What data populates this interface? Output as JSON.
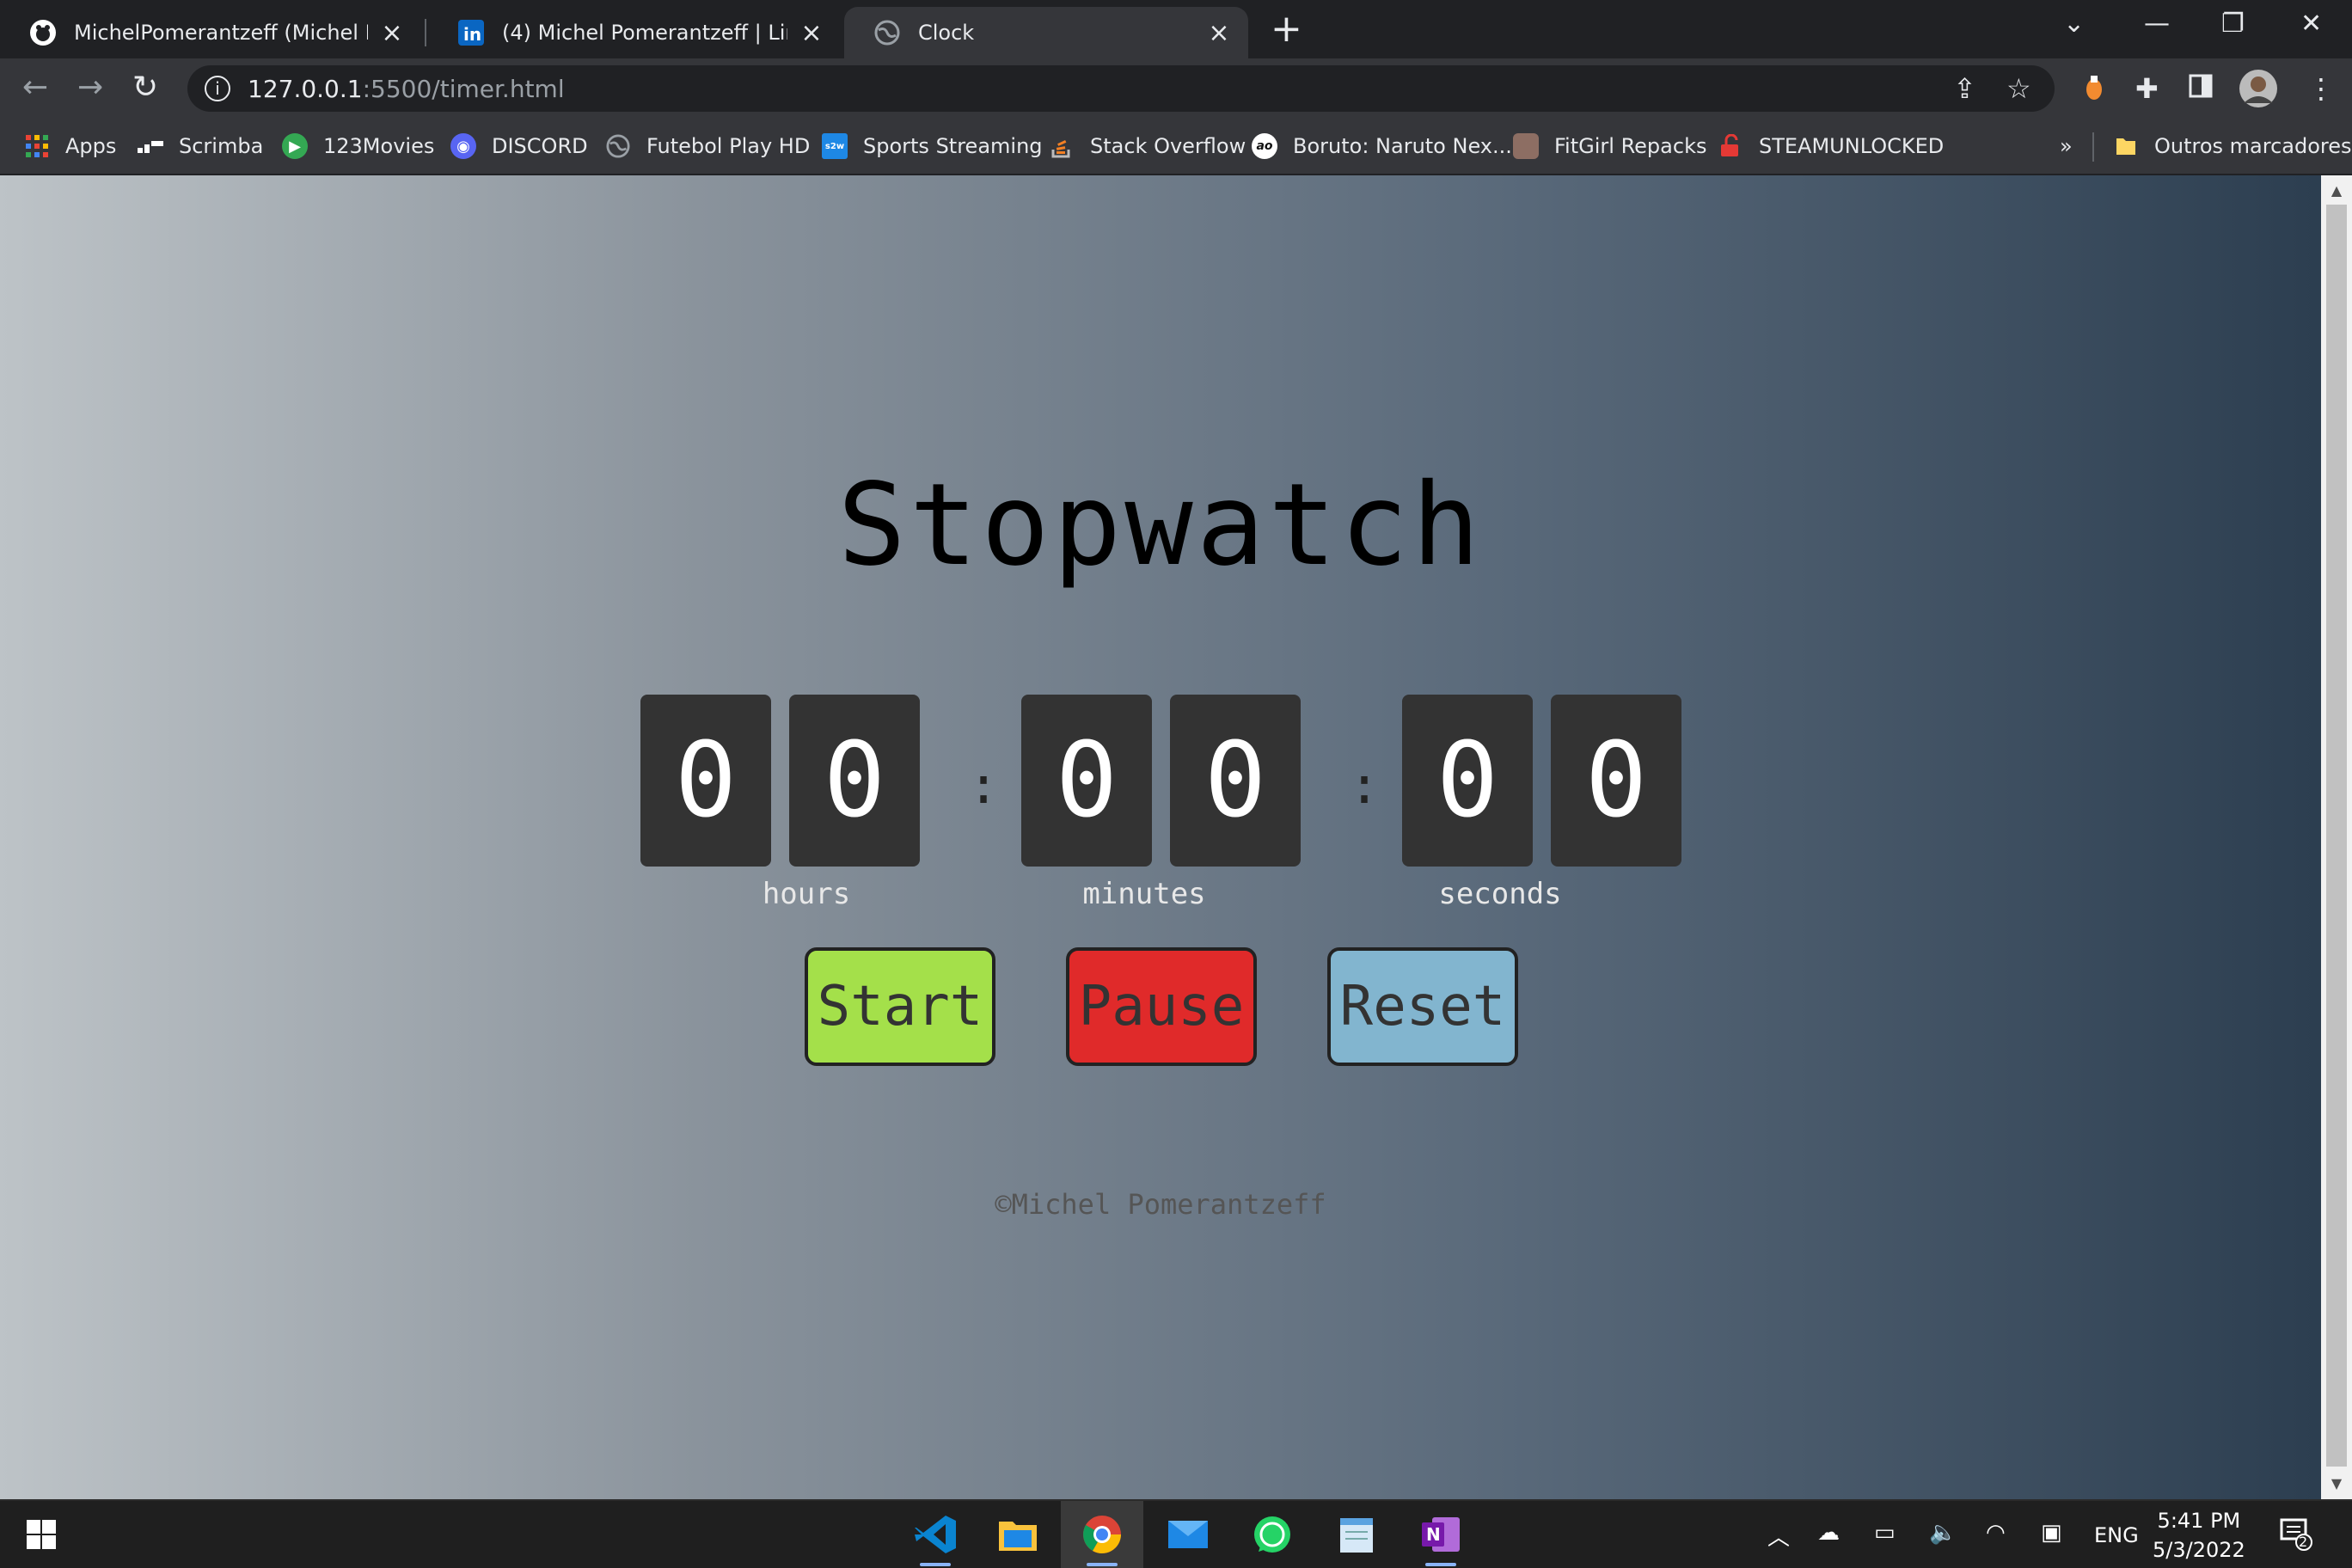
{
  "tabs": [
    {
      "title": "MichelPomerantzeff (Michel Pomerantzeff)",
      "active": false,
      "icon": "github-icon"
    },
    {
      "title": "(4) Michel Pomerantzeff | LinkedIn",
      "active": false,
      "icon": "linkedin-icon"
    },
    {
      "title": "Clock",
      "active": true,
      "icon": "globe-icon"
    }
  ],
  "toolbar": {
    "url_host": "127.0.0.1",
    "url_path": ":5500/timer.html"
  },
  "bookmarks": [
    {
      "label": "Apps",
      "icon": "apps-grid-icon",
      "color": "#ea4335"
    },
    {
      "label": "Scrimba",
      "icon": "scrimba-icon",
      "color": "#5f6368"
    },
    {
      "label": "123Movies",
      "icon": "play-icon",
      "color": "#34a853"
    },
    {
      "label": "DISCORD",
      "icon": "discord-icon",
      "color": "#5865f2"
    },
    {
      "label": "Futebol Play HD",
      "icon": "globe-icon",
      "color": "#5f6368"
    },
    {
      "label": "Sports Streaming",
      "icon": "s2w-icon",
      "color": "#1e88e5"
    },
    {
      "label": "Stack Overflow",
      "icon": "stackoverflow-icon",
      "color": "#f48024"
    },
    {
      "label": "Boruto: Naruto Nex...",
      "icon": "ao-icon",
      "color": "#111111"
    },
    {
      "label": "FitGirl Repacks",
      "icon": "fitgirl-icon",
      "color": "#8d6e63"
    },
    {
      "label": "STEAMUNLOCKED",
      "icon": "steamunlocked-icon",
      "color": "#e53935"
    }
  ],
  "bookmarks_overflow": "»",
  "other_bookmarks": "Outros marcadores",
  "stopwatch": {
    "title": "Stopwatch",
    "digits": [
      "0",
      "0",
      "0",
      "0",
      "0",
      "0"
    ],
    "separator": ":",
    "units": {
      "hours": "hours",
      "minutes": "minutes",
      "seconds": "seconds"
    },
    "buttons": {
      "start": {
        "label": "Start",
        "color": "#a4e04a"
      },
      "pause": {
        "label": "Pause",
        "color": "#e02a2a"
      },
      "reset": {
        "label": "Reset",
        "color": "#82b5cf"
      }
    },
    "footer": "©Michel Pomerantzeff"
  },
  "taskbar": {
    "apps": [
      "vscode-icon",
      "file-explorer-icon",
      "chrome-icon",
      "mail-icon",
      "whatsapp-icon",
      "notepad-icon",
      "onenote-icon"
    ],
    "language": "ENG",
    "time": "5:41 PM",
    "date": "5/3/2022",
    "notification_count": "2"
  }
}
